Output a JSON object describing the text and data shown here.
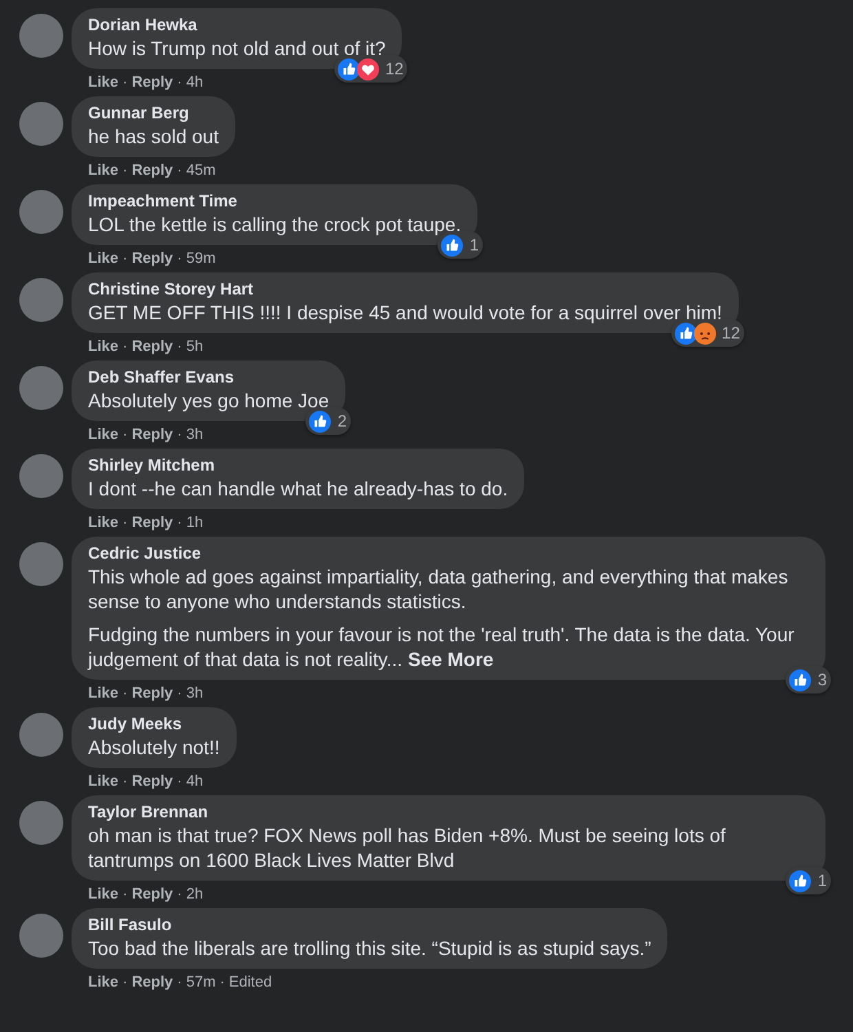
{
  "separator": "·",
  "comments": [
    {
      "author": "Dorian Hewka",
      "paragraphs": [
        "How is Trump not old and out of it?"
      ],
      "reactions": [
        {
          "kind": "like"
        },
        {
          "kind": "love"
        }
      ],
      "reaction_count": "12",
      "meta": [
        "Like",
        "Reply",
        "4h"
      ]
    },
    {
      "author": "Gunnar Berg",
      "paragraphs": [
        "he has sold out"
      ],
      "meta": [
        "Like",
        "Reply",
        "45m"
      ]
    },
    {
      "author": "Impeachment Time",
      "paragraphs": [
        "LOL the kettle is calling the crock pot taupe."
      ],
      "reactions": [
        {
          "kind": "like"
        }
      ],
      "reaction_count": "1",
      "meta": [
        "Like",
        "Reply",
        "59m"
      ]
    },
    {
      "author": "Christine Storey Hart",
      "paragraphs": [
        "GET ME OFF THIS !!!! I despise 45 and would vote for a squirrel over him!"
      ],
      "reactions": [
        {
          "kind": "like"
        },
        {
          "kind": "angry"
        }
      ],
      "reaction_count": "12",
      "meta": [
        "Like",
        "Reply",
        "5h"
      ]
    },
    {
      "author": "Deb Shaffer Evans",
      "paragraphs": [
        "Absolutely yes go home Joe"
      ],
      "reactions": [
        {
          "kind": "like"
        }
      ],
      "reaction_count": "2",
      "meta": [
        "Like",
        "Reply",
        "3h"
      ]
    },
    {
      "author": "Shirley Mitchem",
      "paragraphs": [
        "I dont --he can handle what he already-has to do."
      ],
      "meta": [
        "Like",
        "Reply",
        "1h"
      ]
    },
    {
      "author": "Cedric Justice",
      "paragraphs": [
        "This whole ad goes against impartiality, data gathering, and everything that makes sense to anyone who understands statistics.",
        "Fudging the numbers in your favour is not the 'real truth'. The data is the data. Your judgement of that data is not reality... **See More**"
      ],
      "reactions": [
        {
          "kind": "like"
        }
      ],
      "reaction_count": "3",
      "meta": [
        "Like",
        "Reply",
        "3h"
      ]
    },
    {
      "author": "Judy Meeks",
      "paragraphs": [
        "Absolutely not!!"
      ],
      "meta": [
        "Like",
        "Reply",
        "4h"
      ]
    },
    {
      "author": "Taylor Brennan",
      "paragraphs": [
        "oh man is that true? FOX News poll has Biden +8%. Must be seeing lots of tantrumps on 1600 Black Lives Matter Blvd"
      ],
      "reactions": [
        {
          "kind": "like"
        }
      ],
      "reaction_count": "1",
      "meta": [
        "Like",
        "Reply",
        "2h"
      ]
    },
    {
      "author": "Bill Fasulo",
      "paragraphs": [
        "Too bad the liberals are trolling this site. “Stupid is as stupid says.”"
      ],
      "meta": [
        "Like",
        "Reply",
        "57m",
        "Edited"
      ]
    }
  ]
}
